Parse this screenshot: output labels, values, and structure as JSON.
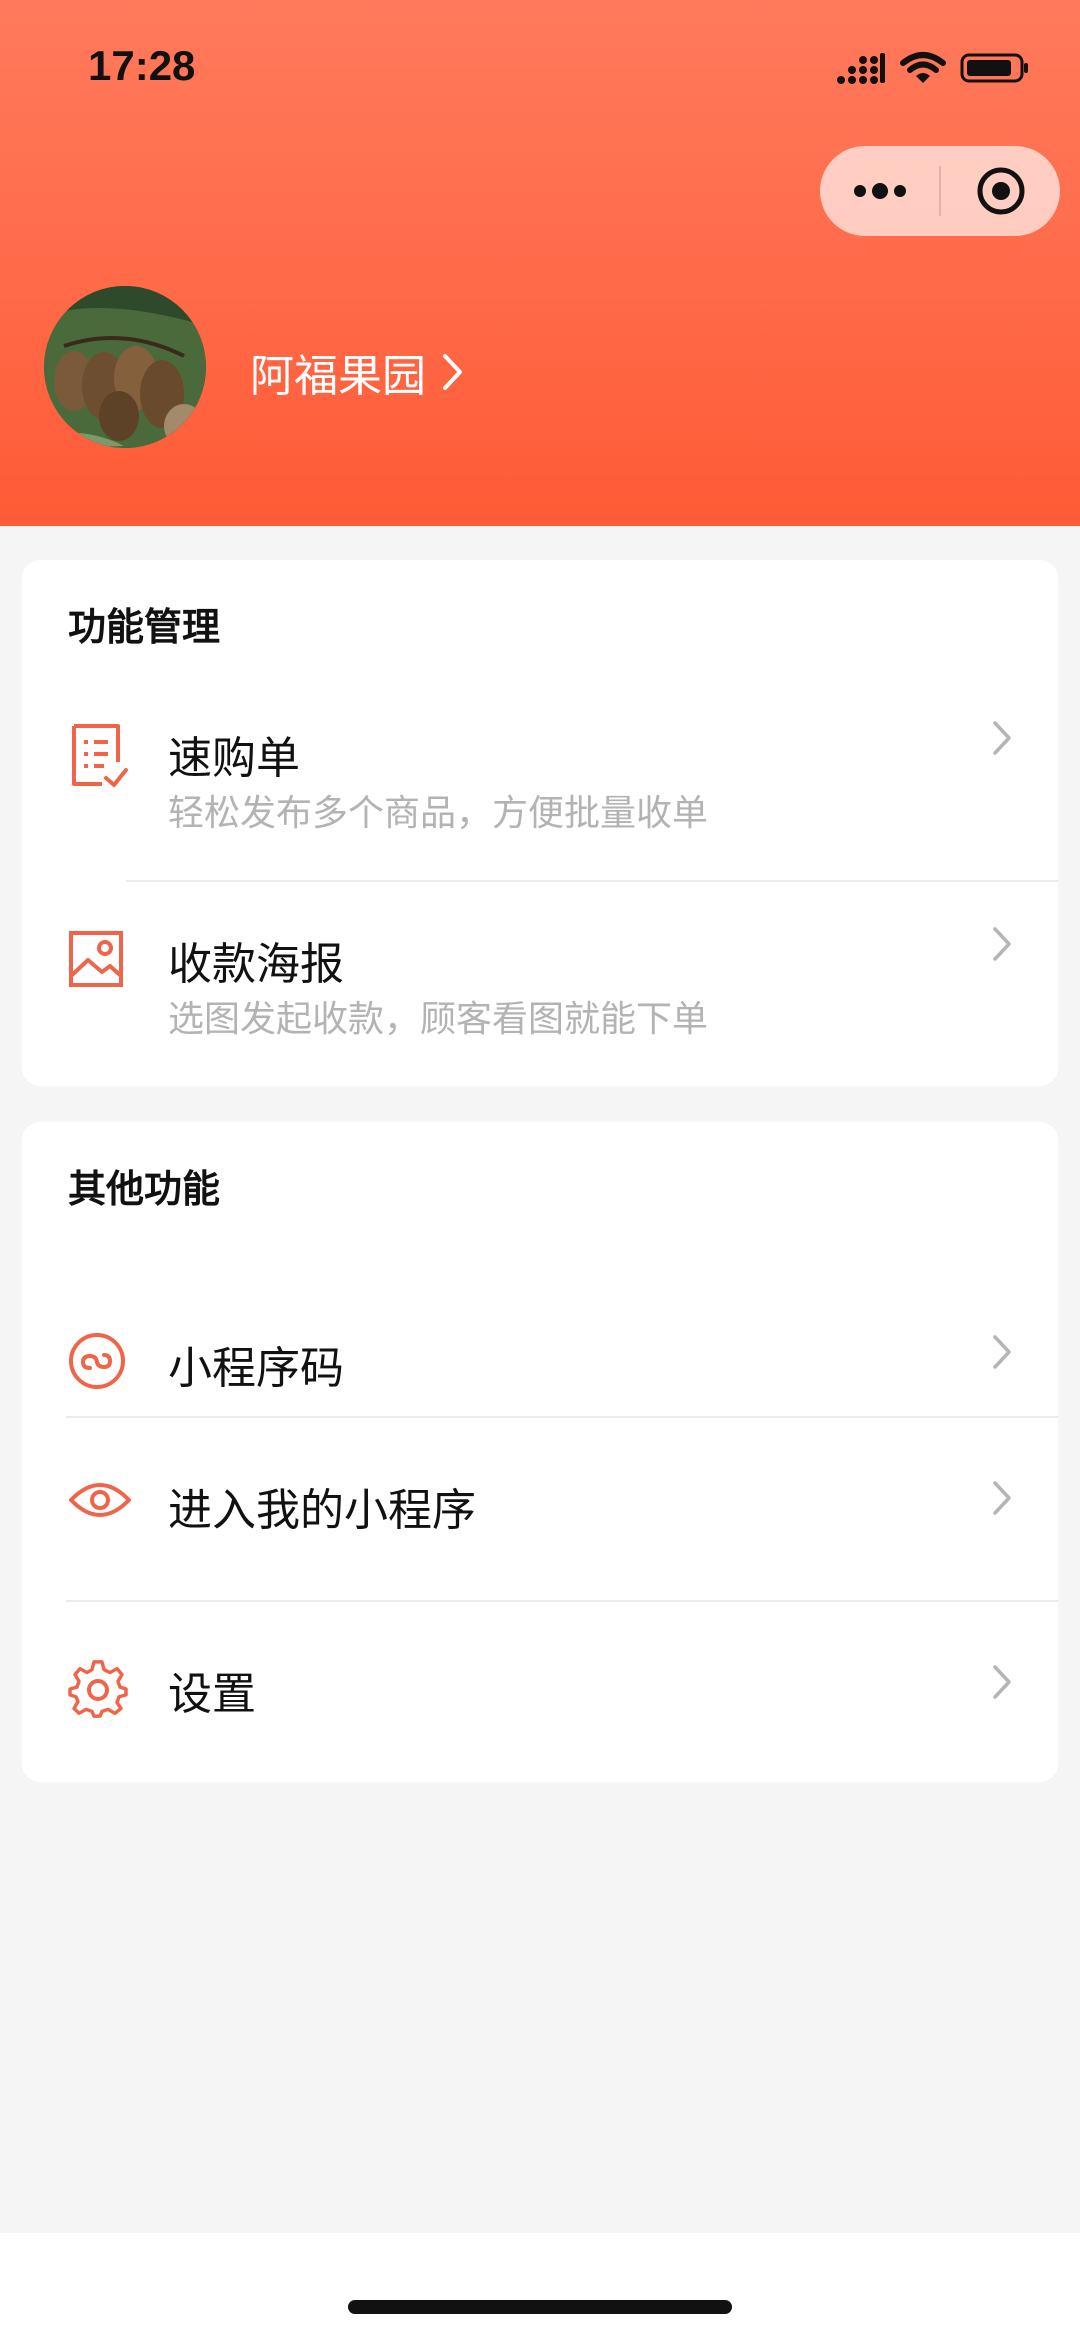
{
  "status_bar": {
    "time": "17:28"
  },
  "header": {
    "shop_name": "阿福果园",
    "capsule": {
      "more_icon": "more-dots-icon",
      "close_icon": "target-circle-icon"
    }
  },
  "function_management": {
    "title": "功能管理",
    "items": [
      {
        "label": "速购单",
        "subtitle": "轻松发布多个商品，方便批量收单",
        "icon": "checklist-icon"
      },
      {
        "label": "收款海报",
        "subtitle": "选图发起收款，顾客看图就能下单",
        "icon": "image-icon"
      }
    ]
  },
  "other_functions": {
    "title": "其他功能",
    "items": [
      {
        "label": "小程序码",
        "icon": "miniprogram-icon"
      },
      {
        "label": "进入我的小程序",
        "icon": "eye-icon"
      },
      {
        "label": "设置",
        "icon": "gear-icon"
      }
    ]
  },
  "colors": {
    "accent": "#f0654a",
    "header_top": "#ff7a5c",
    "header_bottom": "#ff5a36"
  }
}
